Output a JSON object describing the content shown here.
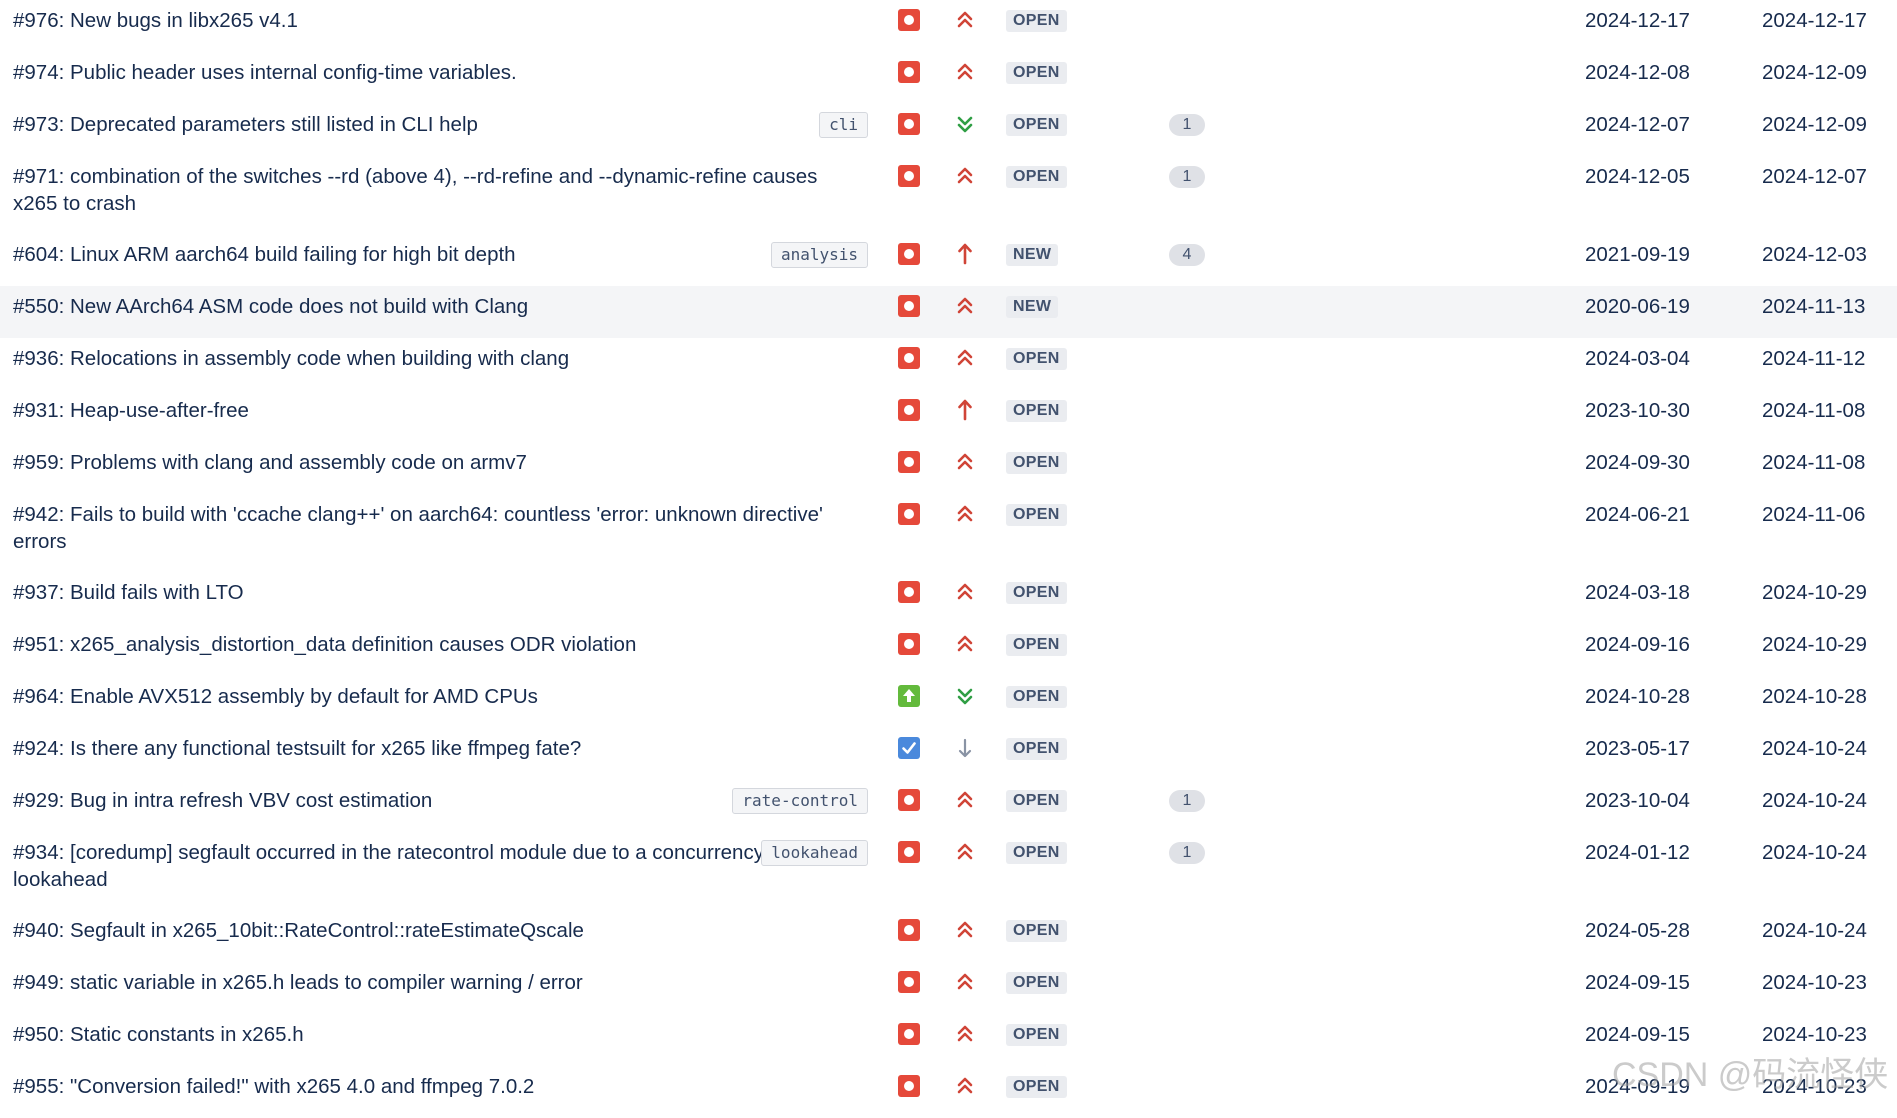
{
  "issues": [
    {
      "summary": "#976: New bugs in libx265 v4.1",
      "label": "",
      "type": "bug",
      "priority": "high",
      "status": "OPEN",
      "count": "",
      "created": "2024-12-17",
      "updated": "2024-12-17"
    },
    {
      "summary": "#974: Public header uses internal config-time variables.",
      "label": "",
      "type": "bug",
      "priority": "high",
      "status": "OPEN",
      "count": "",
      "created": "2024-12-08",
      "updated": "2024-12-09"
    },
    {
      "summary": "#973: Deprecated parameters still listed in CLI help",
      "label": "cli",
      "type": "bug",
      "priority": "lowest",
      "status": "OPEN",
      "count": "1",
      "created": "2024-12-07",
      "updated": "2024-12-09"
    },
    {
      "summary": "#971: combination of the switches --rd (above 4), --rd-refine and --dynamic-refine causes x265 to crash",
      "label": "",
      "type": "bug",
      "priority": "high",
      "status": "OPEN",
      "count": "1",
      "created": "2024-12-05",
      "updated": "2024-12-07"
    },
    {
      "summary": "#604: Linux ARM aarch64 build failing for high bit depth",
      "label": "analysis",
      "type": "bug",
      "priority": "highest",
      "status": "NEW",
      "count": "4",
      "created": "2021-09-19",
      "updated": "2024-12-03"
    },
    {
      "summary": "#550: New AArch64 ASM code does not build with Clang",
      "label": "",
      "type": "bug",
      "priority": "high",
      "status": "NEW",
      "count": "",
      "created": "2020-06-19",
      "updated": "2024-11-13"
    },
    {
      "summary": "#936: Relocations in assembly code when building with clang",
      "label": "",
      "type": "bug",
      "priority": "high",
      "status": "OPEN",
      "count": "",
      "created": "2024-03-04",
      "updated": "2024-11-12"
    },
    {
      "summary": "#931: Heap-use-after-free",
      "label": "",
      "type": "bug",
      "priority": "highest",
      "status": "OPEN",
      "count": "",
      "created": "2023-10-30",
      "updated": "2024-11-08"
    },
    {
      "summary": "#959: Problems with clang and assembly code on armv7",
      "label": "",
      "type": "bug",
      "priority": "high",
      "status": "OPEN",
      "count": "",
      "created": "2024-09-30",
      "updated": "2024-11-08"
    },
    {
      "summary": "#942: Fails to build with 'ccache clang++' on aarch64: countless 'error: unknown directive' errors",
      "label": "",
      "type": "bug",
      "priority": "high",
      "status": "OPEN",
      "count": "",
      "created": "2024-06-21",
      "updated": "2024-11-06"
    },
    {
      "summary": "#937: Build fails with LTO",
      "label": "",
      "type": "bug",
      "priority": "high",
      "status": "OPEN",
      "count": "",
      "created": "2024-03-18",
      "updated": "2024-10-29"
    },
    {
      "summary": "#951: x265_analysis_distortion_data definition causes ODR violation",
      "label": "",
      "type": "bug",
      "priority": "high",
      "status": "OPEN",
      "count": "",
      "created": "2024-09-16",
      "updated": "2024-10-29"
    },
    {
      "summary": "#964: Enable AVX512 assembly by default for AMD CPUs",
      "label": "",
      "type": "improvement",
      "priority": "lowest",
      "status": "OPEN",
      "count": "",
      "created": "2024-10-28",
      "updated": "2024-10-28"
    },
    {
      "summary": "#924: Is there any functional testsuilt for x265 like ffmpeg fate?",
      "label": "",
      "type": "task",
      "priority": "low",
      "status": "OPEN",
      "count": "",
      "created": "2023-05-17",
      "updated": "2024-10-24"
    },
    {
      "summary": "#929: Bug in intra refresh VBV cost estimation",
      "label": "rate-control",
      "type": "bug",
      "priority": "high",
      "status": "OPEN",
      "count": "1",
      "created": "2023-10-04",
      "updated": "2024-10-24"
    },
    {
      "summary": "#934: [coredump] segfault occurred in the ratecontrol module due to a concurrency bug in lookahead",
      "label": "lookahead",
      "type": "bug",
      "priority": "high",
      "status": "OPEN",
      "count": "1",
      "created": "2024-01-12",
      "updated": "2024-10-24"
    },
    {
      "summary": "#940: Segfault in x265_10bit::RateControl::rateEstimateQscale",
      "label": "",
      "type": "bug",
      "priority": "high",
      "status": "OPEN",
      "count": "",
      "created": "2024-05-28",
      "updated": "2024-10-24"
    },
    {
      "summary": "#949: static variable in x265.h leads to compiler warning / error",
      "label": "",
      "type": "bug",
      "priority": "high",
      "status": "OPEN",
      "count": "",
      "created": "2024-09-15",
      "updated": "2024-10-23"
    },
    {
      "summary": "#950: Static constants in x265.h",
      "label": "",
      "type": "bug",
      "priority": "high",
      "status": "OPEN",
      "count": "",
      "created": "2024-09-15",
      "updated": "2024-10-23"
    },
    {
      "summary": "#955: \"Conversion failed!\" with x265 4.0 and ffmpeg 7.0.2",
      "label": "",
      "type": "bug",
      "priority": "high",
      "status": "OPEN",
      "count": "",
      "created": "2024-09-19",
      "updated": "2024-10-23"
    }
  ],
  "watermark": "CSDN @码流怪侠",
  "colors": {
    "bug": "#e5493a",
    "improvement": "#63ba3c",
    "task": "#4a89dc",
    "priority_high": "#d04437",
    "priority_low": "#2f9e44",
    "status_bg": "#eaecf0"
  }
}
